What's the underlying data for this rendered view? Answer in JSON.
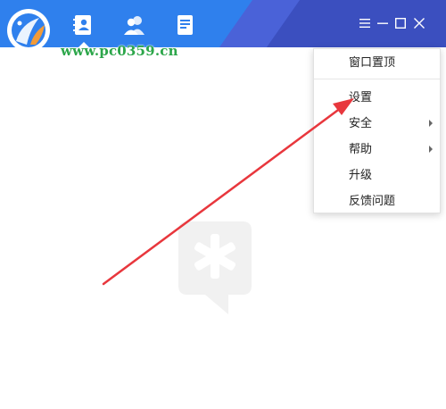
{
  "watermark": {
    "text": "www.pc0359.cn"
  },
  "tabs": [
    {
      "icon": "contacts-card-icon",
      "active": true
    },
    {
      "icon": "group-icon",
      "active": false
    },
    {
      "icon": "document-icon",
      "active": false
    }
  ],
  "window_controls": [
    "menu-icon",
    "minimize-icon",
    "maximize-icon",
    "close-icon"
  ],
  "menu": {
    "items": [
      {
        "label": "窗口置顶",
        "has_submenu": false
      },
      {
        "label": "设置",
        "has_submenu": false
      },
      {
        "label": "安全",
        "has_submenu": true
      },
      {
        "label": "帮助",
        "has_submenu": true
      },
      {
        "label": "升级",
        "has_submenu": false
      },
      {
        "label": "反馈问题",
        "has_submenu": false
      }
    ]
  },
  "colors": {
    "titlebar": "#2f80ed",
    "titlebar_stripe": "#3b4fbf",
    "annotation_arrow": "#e8373d",
    "watermark": "#2ca64a"
  }
}
